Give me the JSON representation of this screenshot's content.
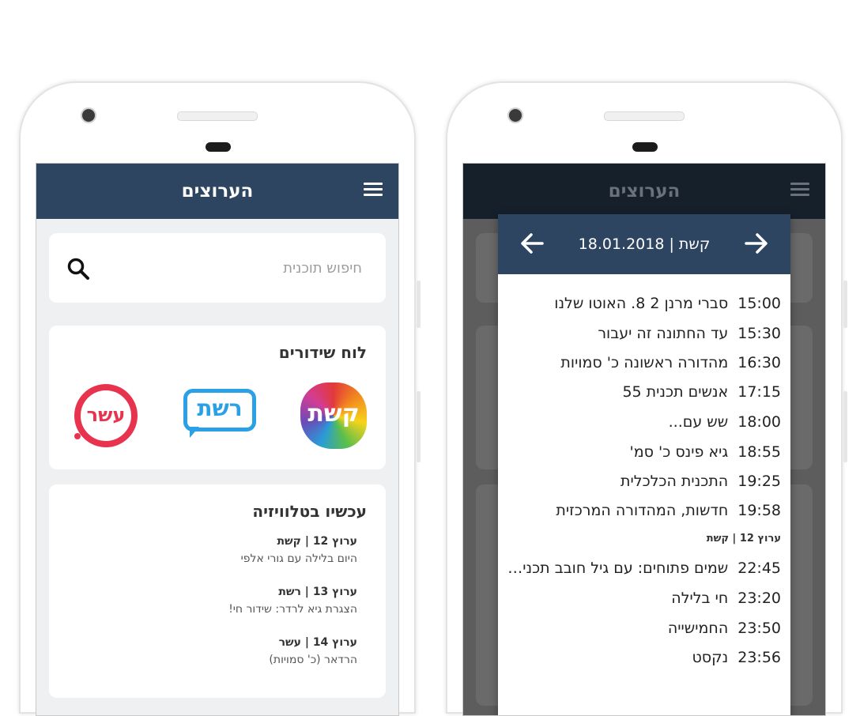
{
  "left_screen": {
    "title": "הערוצים",
    "search": {
      "placeholder": "חיפוש תוכנית"
    },
    "schedule": {
      "title": "לוח שידורים",
      "logos": [
        {
          "name": "keshet",
          "text": "קשת"
        },
        {
          "name": "reshet",
          "text": "רשת"
        },
        {
          "name": "eser",
          "text": "עשר"
        }
      ]
    },
    "now_on_tv": {
      "title": "עכשיו בטלוויזיה",
      "items": [
        {
          "channel": "ערוץ 12 | קשת",
          "show": "היום בלילה עם גורי אלפי"
        },
        {
          "channel": "ערוץ 13 | רשת",
          "show": "הצגרת גיא לרדר: שידור חי!"
        },
        {
          "channel": "ערוץ 14 | עשר",
          "show": "הרדאר (כ' סמויות)"
        }
      ]
    }
  },
  "right_screen": {
    "title": "הערוצים",
    "dialog": {
      "title": "קשת | 18.01.2018",
      "programs": [
        {
          "time": "15:00",
          "name": "סברי מרנן 2 8. האוטו שלנו"
        },
        {
          "time": "15:30",
          "name": "עד החתונה זה יעבור"
        },
        {
          "time": "16:30",
          "name": "מהדורה ראשונה כ' סמויות"
        },
        {
          "time": "17:15",
          "name": "אנשים תכנית 55"
        },
        {
          "time": "18:00",
          "name": "שש עם..."
        },
        {
          "time": "18:55",
          "name": "גיא פינס כ' סמ'"
        },
        {
          "time": "19:25",
          "name": "התכנית הכלכלית"
        },
        {
          "time": "19:58",
          "name": "חדשות, המהדורה המרכזית"
        }
      ],
      "subheader": "ערוץ 12 | קשת",
      "programs_late": [
        {
          "time": "22:45",
          "name": "שמים פתוחים: עם גיל חובב תכנית הבישול"
        },
        {
          "time": "23:20",
          "name": "חי בלילה"
        },
        {
          "time": "23:50",
          "name": "החמישייה"
        },
        {
          "time": "23:56",
          "name": "נקסט"
        }
      ]
    }
  },
  "colors": {
    "appbar": "#2d4560",
    "appbar_dim": "#15202b",
    "reshet": "#2aa0e6",
    "eser": "#e8334f"
  }
}
